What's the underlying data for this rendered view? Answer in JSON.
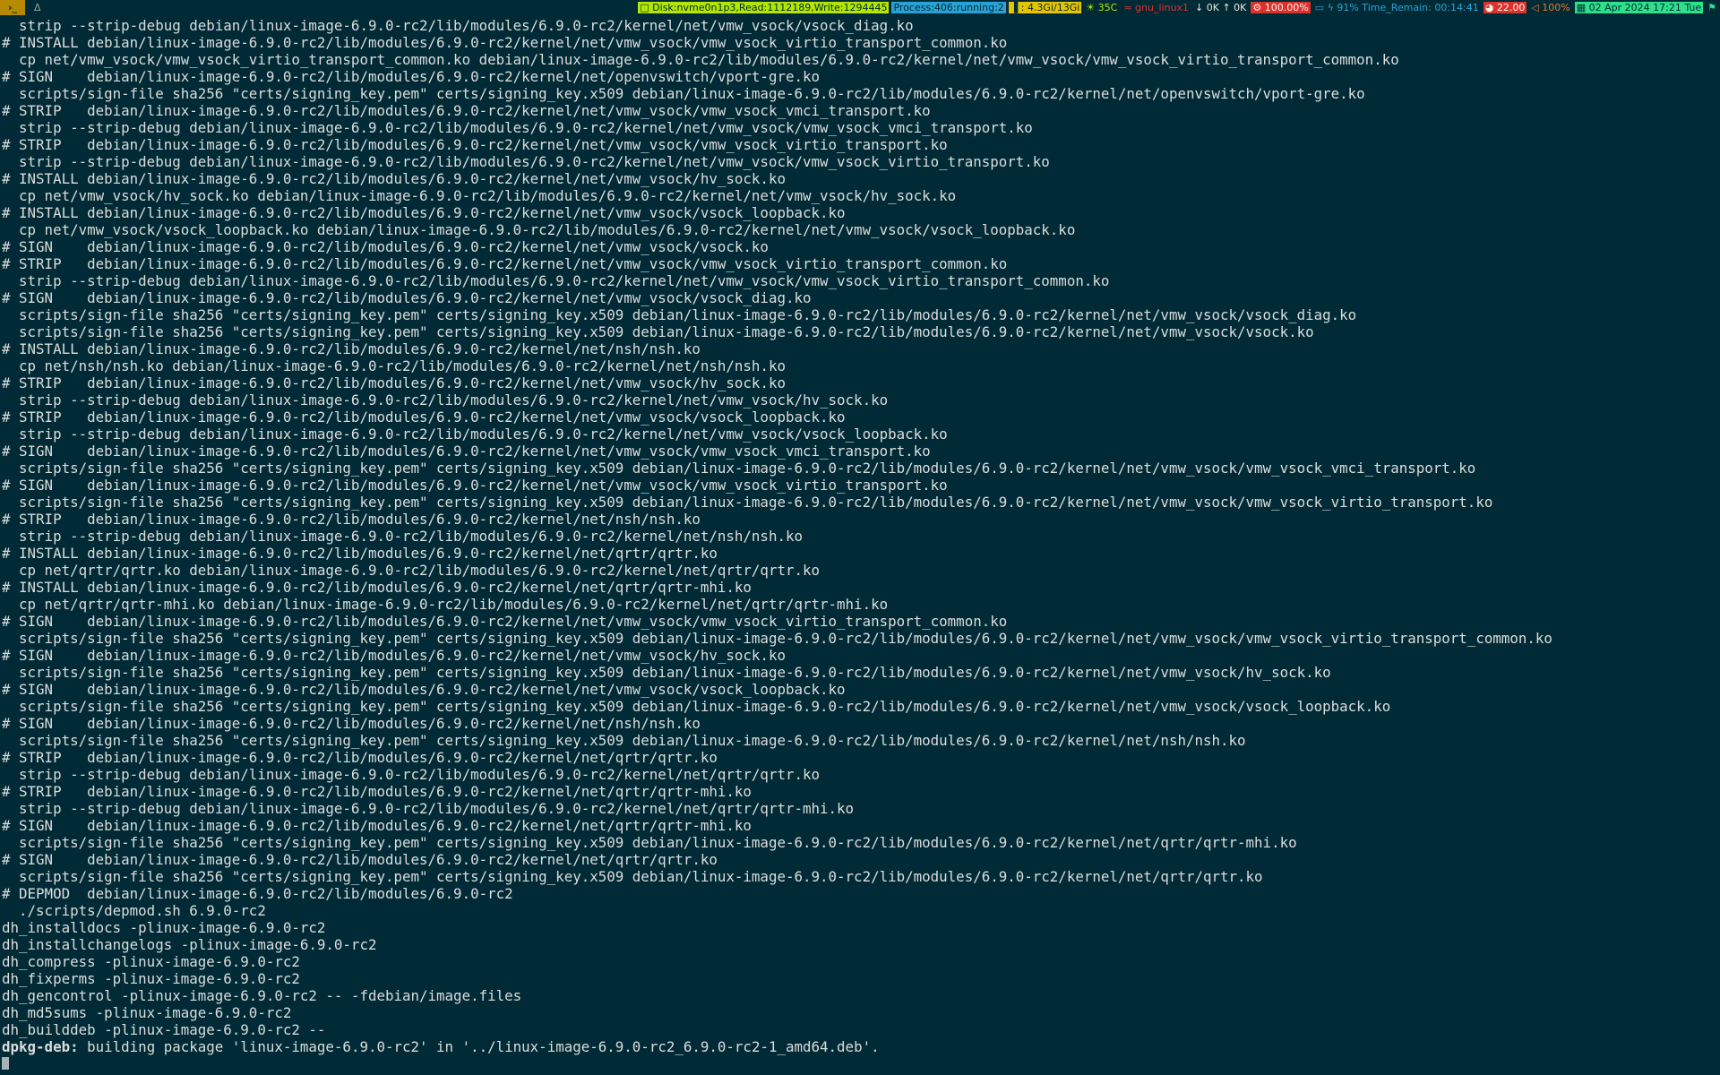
{
  "topbar": {
    "workspace_terminal": "›_",
    "workspace_tux": "Δ",
    "disk": "□ Disk:nvme0n1p3,Read:1112189,Write:1294445",
    "process": "Process:406:running:2",
    "memory": "▐ : 4.3Gi/13Gi",
    "temperature": "☀ 35C",
    "network": "≈ gnu_linux1",
    "io": "↓ 0K ↑ 0K",
    "cpu": "⚙ 100.00%",
    "battery": "▭ ϟ 91% Time_Remain: 00:14:41",
    "load": "◕ 22.00",
    "volume": "◁ 100%",
    "date": "▦ 02 Apr 2024 17:21 Tue",
    "last_icon": "⚑"
  },
  "terminal": {
    "lines": [
      "  strip --strip-debug debian/linux-image-6.9.0-rc2/lib/modules/6.9.0-rc2/kernel/net/vmw_vsock/vsock_diag.ko",
      "# INSTALL debian/linux-image-6.9.0-rc2/lib/modules/6.9.0-rc2/kernel/net/vmw_vsock/vmw_vsock_virtio_transport_common.ko",
      "  cp net/vmw_vsock/vmw_vsock_virtio_transport_common.ko debian/linux-image-6.9.0-rc2/lib/modules/6.9.0-rc2/kernel/net/vmw_vsock/vmw_vsock_virtio_transport_common.ko",
      "# SIGN    debian/linux-image-6.9.0-rc2/lib/modules/6.9.0-rc2/kernel/net/openvswitch/vport-gre.ko",
      "  scripts/sign-file sha256 \"certs/signing_key.pem\" certs/signing_key.x509 debian/linux-image-6.9.0-rc2/lib/modules/6.9.0-rc2/kernel/net/openvswitch/vport-gre.ko",
      "# STRIP   debian/linux-image-6.9.0-rc2/lib/modules/6.9.0-rc2/kernel/net/vmw_vsock/vmw_vsock_vmci_transport.ko",
      "  strip --strip-debug debian/linux-image-6.9.0-rc2/lib/modules/6.9.0-rc2/kernel/net/vmw_vsock/vmw_vsock_vmci_transport.ko",
      "# STRIP   debian/linux-image-6.9.0-rc2/lib/modules/6.9.0-rc2/kernel/net/vmw_vsock/vmw_vsock_virtio_transport.ko",
      "  strip --strip-debug debian/linux-image-6.9.0-rc2/lib/modules/6.9.0-rc2/kernel/net/vmw_vsock/vmw_vsock_virtio_transport.ko",
      "# INSTALL debian/linux-image-6.9.0-rc2/lib/modules/6.9.0-rc2/kernel/net/vmw_vsock/hv_sock.ko",
      "  cp net/vmw_vsock/hv_sock.ko debian/linux-image-6.9.0-rc2/lib/modules/6.9.0-rc2/kernel/net/vmw_vsock/hv_sock.ko",
      "# INSTALL debian/linux-image-6.9.0-rc2/lib/modules/6.9.0-rc2/kernel/net/vmw_vsock/vsock_loopback.ko",
      "  cp net/vmw_vsock/vsock_loopback.ko debian/linux-image-6.9.0-rc2/lib/modules/6.9.0-rc2/kernel/net/vmw_vsock/vsock_loopback.ko",
      "# SIGN    debian/linux-image-6.9.0-rc2/lib/modules/6.9.0-rc2/kernel/net/vmw_vsock/vsock.ko",
      "# STRIP   debian/linux-image-6.9.0-rc2/lib/modules/6.9.0-rc2/kernel/net/vmw_vsock/vmw_vsock_virtio_transport_common.ko",
      "  strip --strip-debug debian/linux-image-6.9.0-rc2/lib/modules/6.9.0-rc2/kernel/net/vmw_vsock/vmw_vsock_virtio_transport_common.ko",
      "# SIGN    debian/linux-image-6.9.0-rc2/lib/modules/6.9.0-rc2/kernel/net/vmw_vsock/vsock_diag.ko",
      "  scripts/sign-file sha256 \"certs/signing_key.pem\" certs/signing_key.x509 debian/linux-image-6.9.0-rc2/lib/modules/6.9.0-rc2/kernel/net/vmw_vsock/vsock_diag.ko",
      "  scripts/sign-file sha256 \"certs/signing_key.pem\" certs/signing_key.x509 debian/linux-image-6.9.0-rc2/lib/modules/6.9.0-rc2/kernel/net/vmw_vsock/vsock.ko",
      "# INSTALL debian/linux-image-6.9.0-rc2/lib/modules/6.9.0-rc2/kernel/net/nsh/nsh.ko",
      "  cp net/nsh/nsh.ko debian/linux-image-6.9.0-rc2/lib/modules/6.9.0-rc2/kernel/net/nsh/nsh.ko",
      "# STRIP   debian/linux-image-6.9.0-rc2/lib/modules/6.9.0-rc2/kernel/net/vmw_vsock/hv_sock.ko",
      "  strip --strip-debug debian/linux-image-6.9.0-rc2/lib/modules/6.9.0-rc2/kernel/net/vmw_vsock/hv_sock.ko",
      "# STRIP   debian/linux-image-6.9.0-rc2/lib/modules/6.9.0-rc2/kernel/net/vmw_vsock/vsock_loopback.ko",
      "  strip --strip-debug debian/linux-image-6.9.0-rc2/lib/modules/6.9.0-rc2/kernel/net/vmw_vsock/vsock_loopback.ko",
      "# SIGN    debian/linux-image-6.9.0-rc2/lib/modules/6.9.0-rc2/kernel/net/vmw_vsock/vmw_vsock_vmci_transport.ko",
      "  scripts/sign-file sha256 \"certs/signing_key.pem\" certs/signing_key.x509 debian/linux-image-6.9.0-rc2/lib/modules/6.9.0-rc2/kernel/net/vmw_vsock/vmw_vsock_vmci_transport.ko",
      "# SIGN    debian/linux-image-6.9.0-rc2/lib/modules/6.9.0-rc2/kernel/net/vmw_vsock/vmw_vsock_virtio_transport.ko",
      "  scripts/sign-file sha256 \"certs/signing_key.pem\" certs/signing_key.x509 debian/linux-image-6.9.0-rc2/lib/modules/6.9.0-rc2/kernel/net/vmw_vsock/vmw_vsock_virtio_transport.ko",
      "# STRIP   debian/linux-image-6.9.0-rc2/lib/modules/6.9.0-rc2/kernel/net/nsh/nsh.ko",
      "  strip --strip-debug debian/linux-image-6.9.0-rc2/lib/modules/6.9.0-rc2/kernel/net/nsh/nsh.ko",
      "# INSTALL debian/linux-image-6.9.0-rc2/lib/modules/6.9.0-rc2/kernel/net/qrtr/qrtr.ko",
      "  cp net/qrtr/qrtr.ko debian/linux-image-6.9.0-rc2/lib/modules/6.9.0-rc2/kernel/net/qrtr/qrtr.ko",
      "# INSTALL debian/linux-image-6.9.0-rc2/lib/modules/6.9.0-rc2/kernel/net/qrtr/qrtr-mhi.ko",
      "  cp net/qrtr/qrtr-mhi.ko debian/linux-image-6.9.0-rc2/lib/modules/6.9.0-rc2/kernel/net/qrtr/qrtr-mhi.ko",
      "# SIGN    debian/linux-image-6.9.0-rc2/lib/modules/6.9.0-rc2/kernel/net/vmw_vsock/vmw_vsock_virtio_transport_common.ko",
      "  scripts/sign-file sha256 \"certs/signing_key.pem\" certs/signing_key.x509 debian/linux-image-6.9.0-rc2/lib/modules/6.9.0-rc2/kernel/net/vmw_vsock/vmw_vsock_virtio_transport_common.ko",
      "# SIGN    debian/linux-image-6.9.0-rc2/lib/modules/6.9.0-rc2/kernel/net/vmw_vsock/hv_sock.ko",
      "  scripts/sign-file sha256 \"certs/signing_key.pem\" certs/signing_key.x509 debian/linux-image-6.9.0-rc2/lib/modules/6.9.0-rc2/kernel/net/vmw_vsock/hv_sock.ko",
      "# SIGN    debian/linux-image-6.9.0-rc2/lib/modules/6.9.0-rc2/kernel/net/vmw_vsock/vsock_loopback.ko",
      "  scripts/sign-file sha256 \"certs/signing_key.pem\" certs/signing_key.x509 debian/linux-image-6.9.0-rc2/lib/modules/6.9.0-rc2/kernel/net/vmw_vsock/vsock_loopback.ko",
      "# SIGN    debian/linux-image-6.9.0-rc2/lib/modules/6.9.0-rc2/kernel/net/nsh/nsh.ko",
      "  scripts/sign-file sha256 \"certs/signing_key.pem\" certs/signing_key.x509 debian/linux-image-6.9.0-rc2/lib/modules/6.9.0-rc2/kernel/net/nsh/nsh.ko",
      "# STRIP   debian/linux-image-6.9.0-rc2/lib/modules/6.9.0-rc2/kernel/net/qrtr/qrtr.ko",
      "  strip --strip-debug debian/linux-image-6.9.0-rc2/lib/modules/6.9.0-rc2/kernel/net/qrtr/qrtr.ko",
      "# STRIP   debian/linux-image-6.9.0-rc2/lib/modules/6.9.0-rc2/kernel/net/qrtr/qrtr-mhi.ko",
      "  strip --strip-debug debian/linux-image-6.9.0-rc2/lib/modules/6.9.0-rc2/kernel/net/qrtr/qrtr-mhi.ko",
      "# SIGN    debian/linux-image-6.9.0-rc2/lib/modules/6.9.0-rc2/kernel/net/qrtr/qrtr-mhi.ko",
      "  scripts/sign-file sha256 \"certs/signing_key.pem\" certs/signing_key.x509 debian/linux-image-6.9.0-rc2/lib/modules/6.9.0-rc2/kernel/net/qrtr/qrtr-mhi.ko",
      "# SIGN    debian/linux-image-6.9.0-rc2/lib/modules/6.9.0-rc2/kernel/net/qrtr/qrtr.ko",
      "  scripts/sign-file sha256 \"certs/signing_key.pem\" certs/signing_key.x509 debian/linux-image-6.9.0-rc2/lib/modules/6.9.0-rc2/kernel/net/qrtr/qrtr.ko",
      "# DEPMOD  debian/linux-image-6.9.0-rc2/lib/modules/6.9.0-rc2",
      "  ./scripts/depmod.sh 6.9.0-rc2",
      "dh_installdocs -plinux-image-6.9.0-rc2",
      "dh_installchangelogs -plinux-image-6.9.0-rc2",
      "dh_compress -plinux-image-6.9.0-rc2",
      "dh_fixperms -plinux-image-6.9.0-rc2",
      "dh_gencontrol -plinux-image-6.9.0-rc2 -- -fdebian/image.files",
      "dh_md5sums -plinux-image-6.9.0-rc2",
      "dh_builddeb -plinux-image-6.9.0-rc2 --"
    ],
    "final_prefix": "dpkg-deb:",
    "final_rest": " building package 'linux-image-6.9.0-rc2' in '../linux-image-6.9.0-rc2_6.9.0-rc2-1_amd64.deb'."
  }
}
